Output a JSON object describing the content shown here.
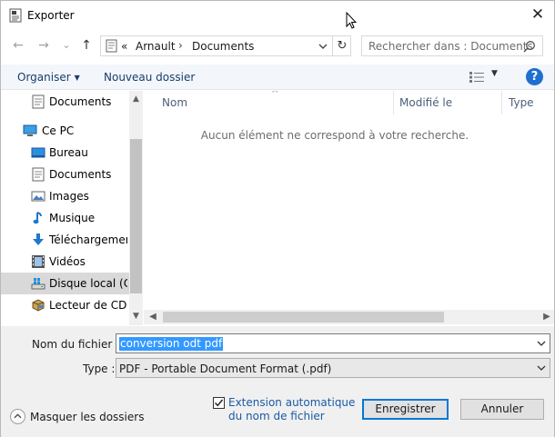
{
  "window": {
    "title": "Exporter",
    "close_glyph": "✕",
    "app_icon": "document-icon"
  },
  "nav": {
    "back_glyph": "←",
    "forward_glyph": "→",
    "recent_glyph": "⌄",
    "up_glyph": "↑",
    "address": {
      "overflow": "«",
      "crumbs": [
        "Arnault",
        "Documents"
      ],
      "separator": "›",
      "refresh_glyph": "↻"
    },
    "search": {
      "placeholder": "Rechercher dans : Documents"
    }
  },
  "toolbar": {
    "organize_label": "Organiser",
    "new_folder_label": "Nouveau dossier",
    "help_glyph": "?"
  },
  "navpane": {
    "items": [
      {
        "label": "Documents",
        "icon": "documents-icon"
      },
      {
        "label": "Ce PC",
        "icon": "pc-icon"
      },
      {
        "label": "Bureau",
        "icon": "desktop-icon"
      },
      {
        "label": "Documents",
        "icon": "documents-icon"
      },
      {
        "label": "Images",
        "icon": "pictures-icon"
      },
      {
        "label": "Musique",
        "icon": "music-icon"
      },
      {
        "label": "Téléchargements",
        "icon": "downloads-icon"
      },
      {
        "label": "Vidéos",
        "icon": "videos-icon"
      },
      {
        "label": "Disque local (C:)",
        "icon": "drive-icon",
        "selected": true
      },
      {
        "label": "Lecteur de CD (D:)",
        "icon": "cd-drive-icon"
      }
    ]
  },
  "filelist": {
    "columns": [
      "Nom",
      "Modifié le",
      "Type"
    ],
    "empty_message": "Aucun élément ne correspond à votre recherche."
  },
  "form": {
    "filename_label": "Nom du fichier :",
    "filename_value": "conversion odt pdf",
    "type_label": "Type :",
    "type_value": "PDF - Portable Document Format (.pdf)",
    "hide_folders_label": "Masquer les dossiers",
    "auto_extension_line1": "Extension automatique",
    "auto_extension_line2": "du nom de fichier",
    "auto_extension_checked": true,
    "save_label": "Enregistrer",
    "cancel_label": "Annuler"
  },
  "colors": {
    "accent": "#0078d7",
    "selection": "#3399ff",
    "link": "#1a5aa6",
    "toolbar_bg": "#f3f6fb"
  }
}
